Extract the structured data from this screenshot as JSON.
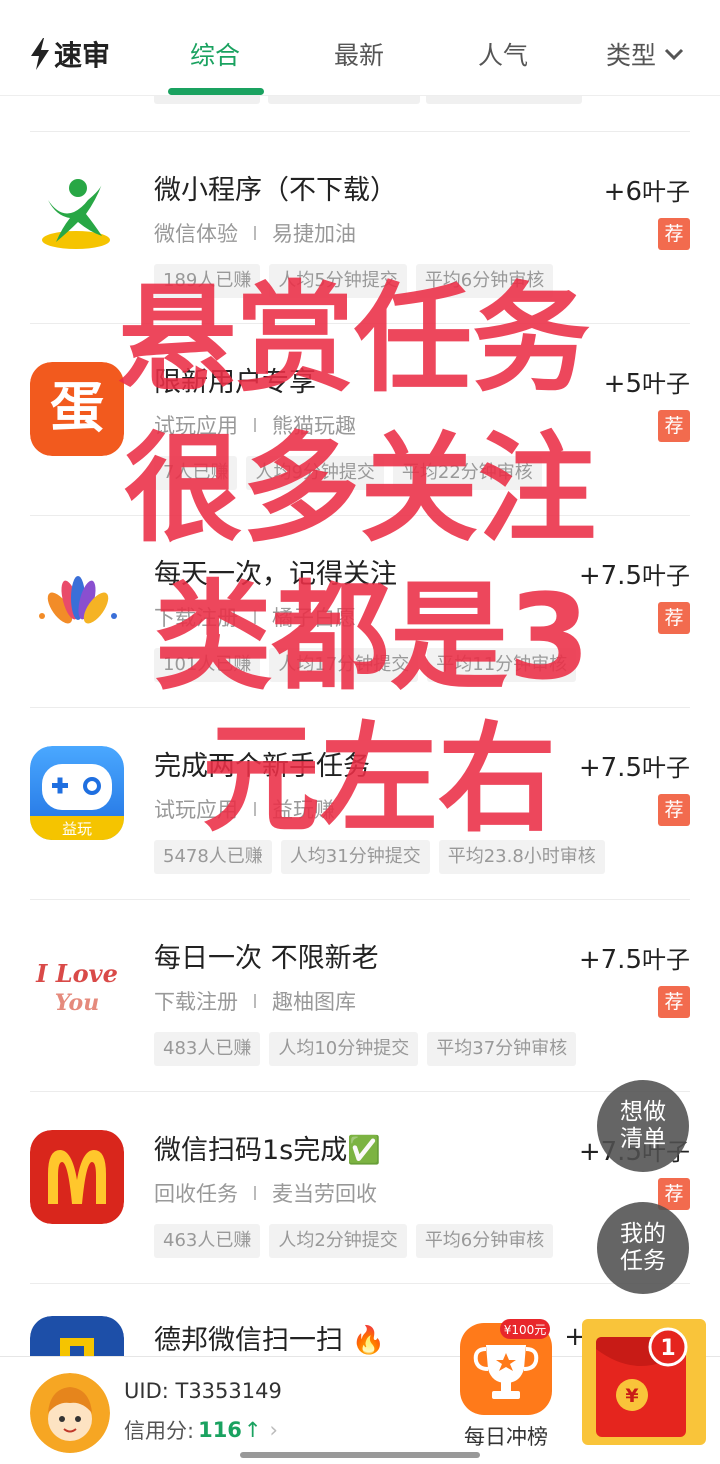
{
  "header": {
    "logo_text": "速审",
    "tabs": [
      {
        "label": "综合",
        "active": true
      },
      {
        "label": "最新",
        "active": false
      },
      {
        "label": "人气",
        "active": false
      },
      {
        "label": "类型",
        "active": false
      }
    ],
    "accent_color": "#1aa260"
  },
  "tasks": [
    {
      "title": "微小程序（不下载）",
      "reward_num": "+6",
      "reward_unit": "叶子",
      "category": "微信体验",
      "merchant": "易捷加油",
      "badge": "荐",
      "chips": [
        "189人已赚",
        "人均5分钟提交",
        "平均6分钟审核"
      ],
      "icon": "running-person-icon"
    },
    {
      "title": "限新用户专享",
      "reward_num": "+5",
      "reward_unit": "叶子",
      "category": "试玩应用",
      "merchant": "熊猫玩趣",
      "badge": "荐",
      "chips": [
        "7人已赚",
        "人均9分钟提交",
        "平均22分钟审核"
      ],
      "icon": "egg-app-icon"
    },
    {
      "title": "每天一次，记得关注",
      "reward_num": "+7.5",
      "reward_unit": "叶子",
      "category": "下载注册",
      "merchant": "橘子白愿",
      "badge": "荐",
      "chips": [
        "101人已赚",
        "人均17分钟提交",
        "平均11分钟审核"
      ],
      "icon": "colorful-petals-icon"
    },
    {
      "title": "完成两个新手任务",
      "reward_num": "+7.5",
      "reward_unit": "叶子",
      "category": "试玩应用",
      "merchant": "益玩赚",
      "badge": "荐",
      "chips": [
        "5478人已赚",
        "人均31分钟提交",
        "平均23.8小时审核"
      ],
      "icon": "gamepad-app-icon",
      "icon_text": "益玩"
    },
    {
      "title": "每日一次 不限新老",
      "reward_num": "+7.5",
      "reward_unit": "叶子",
      "category": "下载注册",
      "merchant": "趣柚图库",
      "badge": "荐",
      "chips": [
        "483人已赚",
        "人均10分钟提交",
        "平均37分钟审核"
      ],
      "icon": "i-love-you-icon",
      "icon_text": "I Love You"
    },
    {
      "title": "微信扫码1s完成✅",
      "reward_num": "+7.5",
      "reward_unit": "叶子",
      "category": "回收任务",
      "merchant": "麦当劳回收",
      "badge": "荐",
      "chips": [
        "463人已赚",
        "人均2分钟提交",
        "平均6分钟审核"
      ],
      "icon": "mcdonalds-icon"
    },
    {
      "title": "德邦微信扫一扫 🔥",
      "reward_num": "+",
      "reward_unit": "",
      "category": "",
      "merchant": "",
      "badge": "",
      "chips": [],
      "icon": "deppon-icon"
    }
  ],
  "overlay_text": [
    "悬赏任务",
    "很多关注",
    "类都是3",
    "元左右"
  ],
  "floating": {
    "wishlist": "想做清单",
    "my_tasks": "我的任务"
  },
  "bottom": {
    "uid_label": "UID: T3353149",
    "credit_label": "信用分:",
    "credit_score": "116",
    "credit_arrow": "↑",
    "chevron": "›",
    "rank_badge": "¥100元",
    "rank_label": "每日冲榜",
    "redpack_count": "1",
    "redpack_symbol": "¥"
  }
}
